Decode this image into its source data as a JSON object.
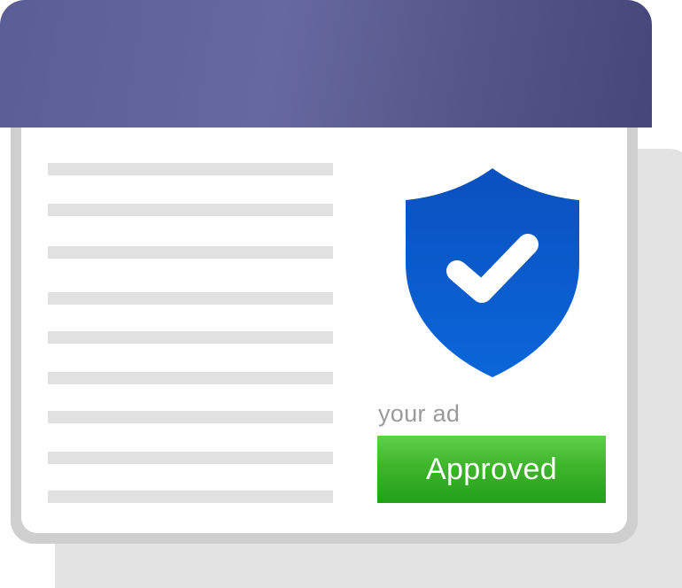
{
  "ad_review": {
    "caption": "your ad",
    "status_label": "Approved"
  },
  "icons": {
    "shield": "shield-check-icon"
  },
  "colors": {
    "titlebar_accent": "#5b5d96",
    "shield_blue": "#0a5bcf",
    "approved_green": "#3fb52c",
    "placeholder_line": "#e1e1e1"
  }
}
